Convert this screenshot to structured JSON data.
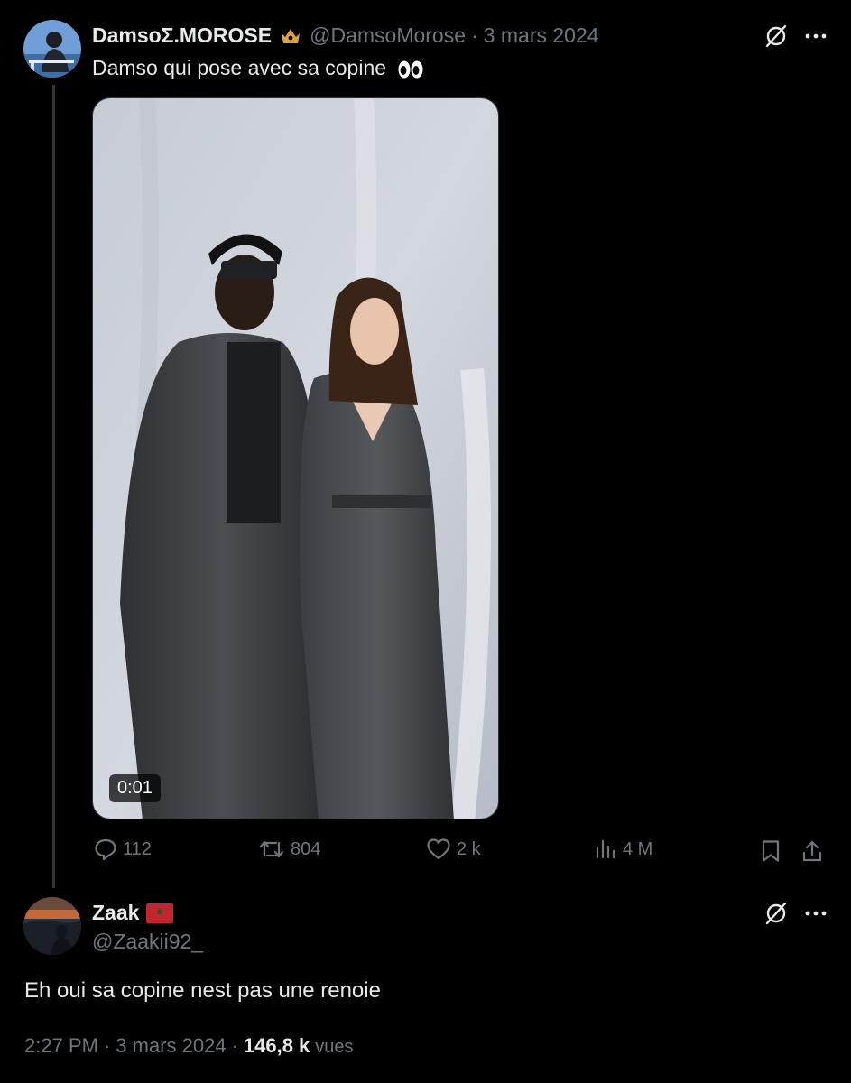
{
  "original_tweet": {
    "display_name": "DamsoΣ.MOROSE",
    "handle": "@DamsoMorose",
    "date": "3 mars 2024",
    "separator": "·",
    "text": "Damso qui pose avec sa copine",
    "text_emoji": "eyes-emoji",
    "media": {
      "type": "video",
      "duration": "0:01"
    },
    "actions": {
      "replies": "112",
      "reposts": "804",
      "likes": "2 k",
      "views": "4 M"
    }
  },
  "reply_tweet": {
    "display_name": "Zaak",
    "flag": "morocco-flag-icon",
    "handle": "@Zaakii92_",
    "text": "Eh oui sa copine nest pas une renoie",
    "time": "2:27 PM",
    "separator": "·",
    "date": "3 mars 2024",
    "views_count": "146,8 k",
    "views_label": "vues"
  },
  "colors": {
    "background": "#000000",
    "text": "#e7e9ea",
    "muted": "#71767b",
    "border": "#2f3336",
    "badge": "#e0a43a",
    "flag_red": "#c1272d",
    "flag_green": "#006233"
  }
}
